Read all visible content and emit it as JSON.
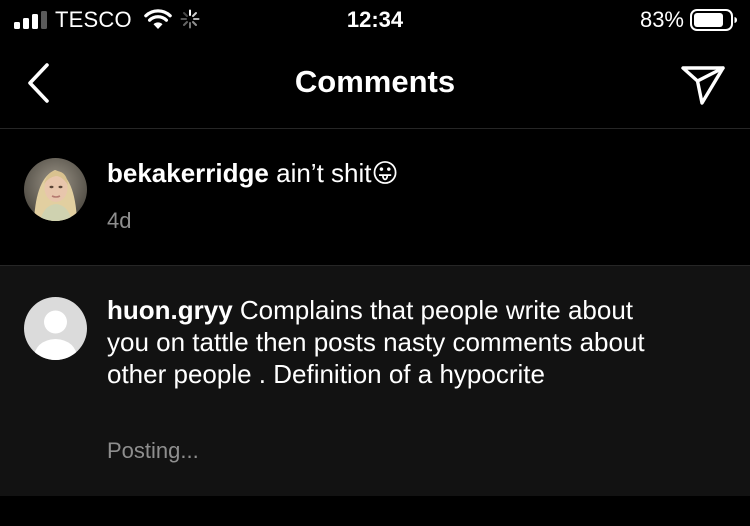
{
  "status_bar": {
    "carrier": "TESCO",
    "time": "12:34",
    "battery_percent": "83%",
    "battery_level": 0.83,
    "signal_bars": 3
  },
  "nav": {
    "title": "Comments",
    "back_icon": "chevron-left-icon",
    "share_icon": "paper-plane-icon"
  },
  "caption": {
    "username": "bekakerridge",
    "text": "ain’t shit😛",
    "time": "4d"
  },
  "comment": {
    "username": "huon.gryy",
    "text": "Complains that people write about you on tattle then posts nasty comments about other people . Definition of a hypocrite",
    "status": "Posting..."
  },
  "colors": {
    "background": "#000000",
    "comment_background": "#121212",
    "secondary_text": "#8e8e8e",
    "divider": "#262626"
  }
}
